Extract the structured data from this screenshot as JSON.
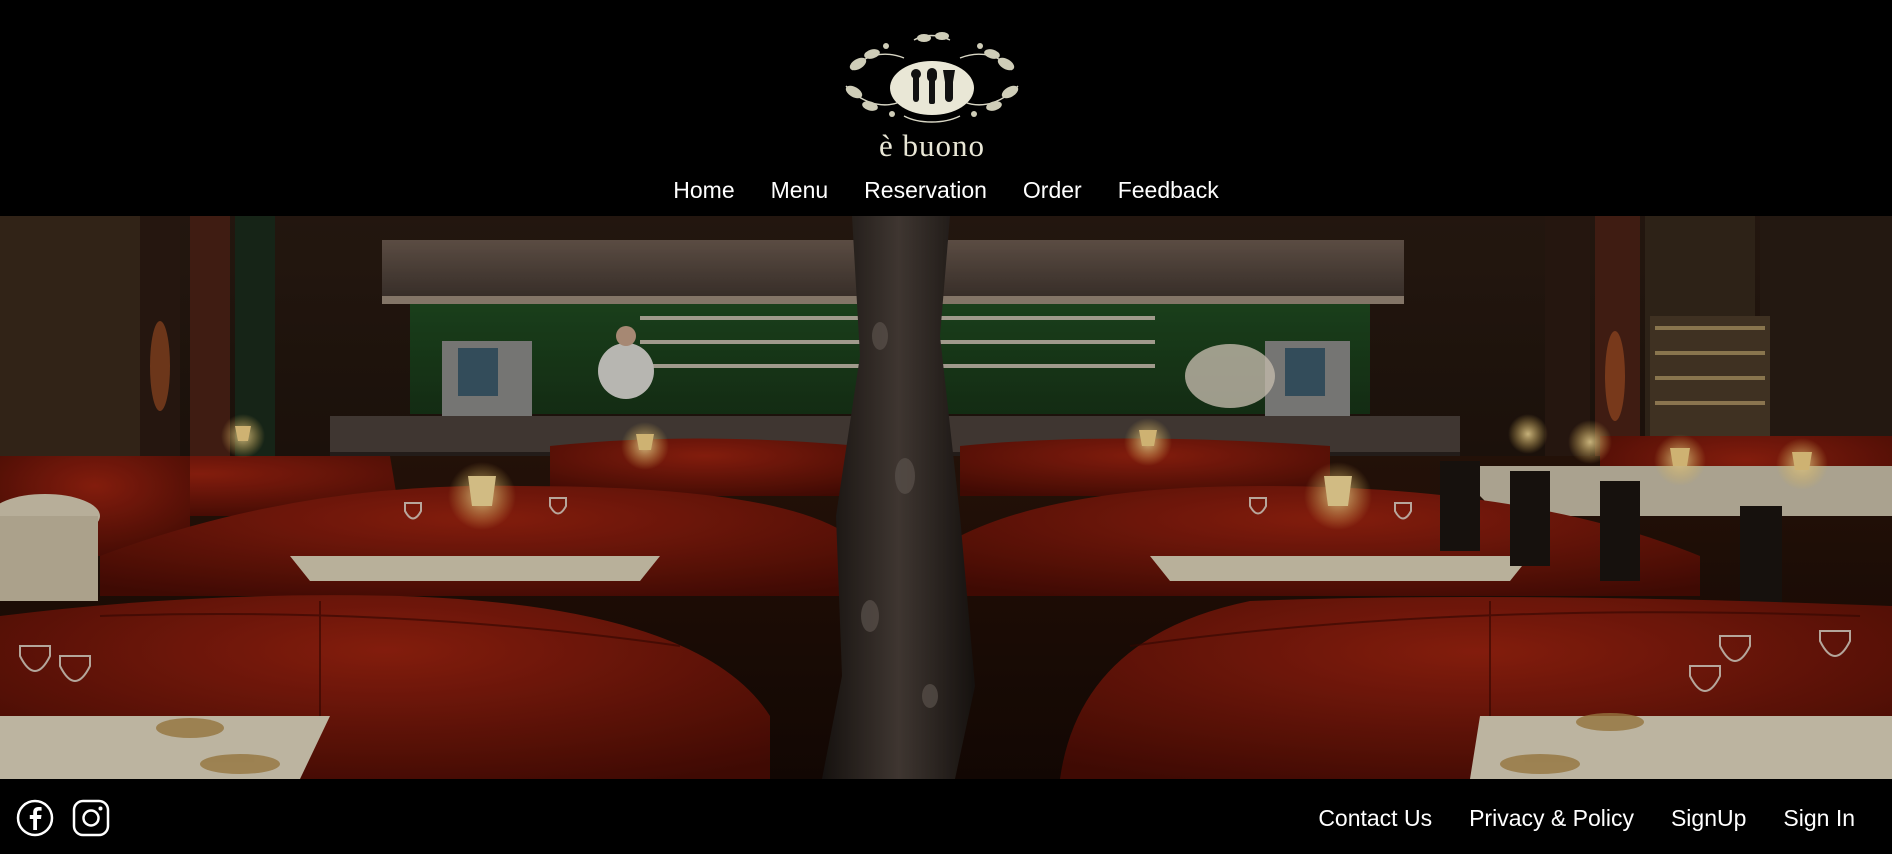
{
  "brand": {
    "name": "è buono",
    "logo_icon": "utensils-emblem-icon"
  },
  "nav": {
    "items": [
      {
        "label": "Home"
      },
      {
        "label": "Menu"
      },
      {
        "label": "Reservation"
      },
      {
        "label": "Order"
      },
      {
        "label": "Feedback"
      }
    ]
  },
  "hero": {
    "image": "restaurant-dining-room-photo"
  },
  "footer": {
    "social": [
      {
        "icon": "facebook-icon"
      },
      {
        "icon": "instagram-icon"
      }
    ],
    "links": [
      {
        "label": "Contact Us"
      },
      {
        "label": "Privacy & Policy"
      },
      {
        "label": "SignUp"
      },
      {
        "label": "Sign In"
      }
    ]
  },
  "colors": {
    "background": "#000000",
    "text": "#ffffff",
    "logo_cream": "#e9e7d6",
    "booth_red": "#7a1608"
  }
}
